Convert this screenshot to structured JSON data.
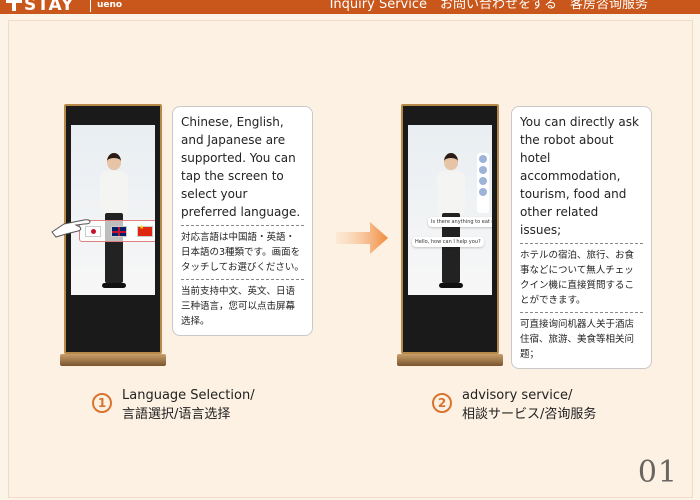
{
  "header": {
    "brand": "STAY",
    "sub_brand": "ueno",
    "title": "Inquiry Service　お問い合わせをする　客房咨询服务"
  },
  "step1": {
    "number": "1",
    "label_en": "Language Selection/",
    "label_jp_cn": "言語選択/语言选择",
    "card_en": "Chinese, English, and Japanese are supported. You can tap the screen to select your preferred language.",
    "card_jp": "対応言語は中国語・英語・日本語の3種類です。画面をタッチしてお選びください。",
    "card_cn": "当前支持中文、英文、日语三种语言，您可以点击屏幕选择。"
  },
  "step2": {
    "number": "2",
    "label_en": "advisory service/",
    "label_jp_cn": "相談サービス/咨询服务",
    "card_en": "You can directly ask the robot about hotel accommodation, tourism, food and other related issues;",
    "card_jp": "ホテルの宿泊、旅行、お食事などについて無人チェックイン機に直接質問することができます。",
    "card_cn": "可直接询问机器人关于酒店住宿、旅游、美食等相关问题；"
  },
  "kiosk2": {
    "bubble_1": "Is there anything to eat nearby?",
    "bubble_2": "Hello, how can I help you?"
  },
  "page_number": "01",
  "colors": {
    "accent": "#c9561a",
    "step": "#d9742f",
    "background": "#fcf1e3"
  }
}
